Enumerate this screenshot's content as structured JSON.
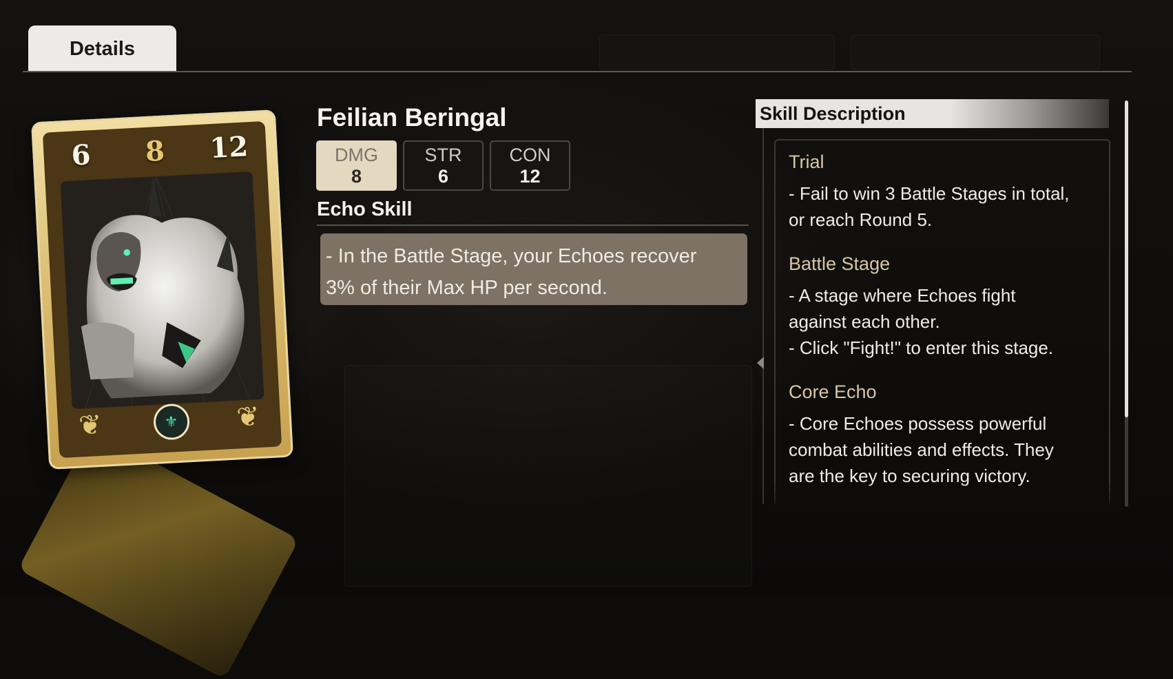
{
  "tabs": [
    {
      "label": "Details",
      "active": true
    }
  ],
  "card": {
    "damage": "6",
    "cost": "8",
    "constitution": "12",
    "emblem_icon": "echo-emblem-icon",
    "frame_color": "#d6b668",
    "art": "white-ape-monster-illustration"
  },
  "echo": {
    "name": "Feilian Beringal",
    "stats": [
      {
        "label": "DMG",
        "value": "8",
        "active": true
      },
      {
        "label": "STR",
        "value": "6",
        "active": false
      },
      {
        "label": "CON",
        "value": "12",
        "active": false
      }
    ],
    "skill_heading": "Echo Skill",
    "skill_lines": [
      "- In the Battle Stage, your Echoes recover",
      "3% of their Max HP per second."
    ]
  },
  "description": {
    "heading": "Skill Description",
    "sections": [
      {
        "title": "Trial",
        "lines": [
          "- Fail to win 3 Battle Stages in total,",
          "or reach Round 5."
        ]
      },
      {
        "title": "Battle Stage",
        "lines": [
          "- A stage where Echoes fight",
          "against each other.",
          "- Click \"Fight!\" to enter this stage."
        ]
      },
      {
        "title": "Core Echo",
        "lines": [
          "- Core Echoes possess powerful",
          "combat abilities and effects. They",
          "are the key to securing victory."
        ]
      }
    ]
  },
  "colors": {
    "accent_title": "#d7c7a4",
    "active_stat_bg": "#e4d8c1",
    "skill_box_bg": "#7d7264"
  }
}
